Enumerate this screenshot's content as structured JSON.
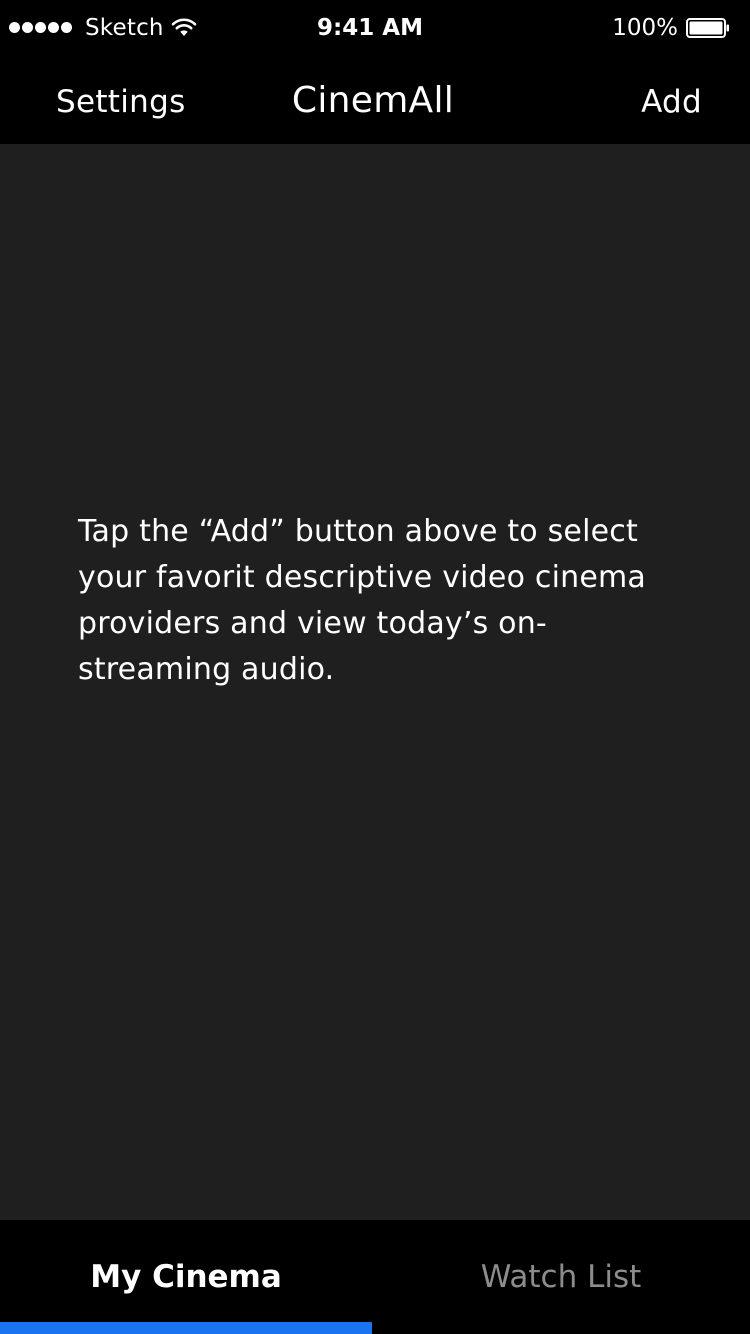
{
  "status_bar": {
    "carrier": "Sketch",
    "time": "9:41 AM",
    "battery_percent": "100%",
    "signal_bars": 5,
    "battery_level": 1.0,
    "icons": [
      "signal-dots-icon",
      "wifi-icon",
      "battery-icon"
    ]
  },
  "nav_bar": {
    "left_button_label": "Settings",
    "title": "CinemAll",
    "right_button_label": "Add"
  },
  "main": {
    "empty_state_message": "Tap the “Add” button above to select your favorit descriptive video cinema providers and view today’s on-streaming audio."
  },
  "tab_bar": {
    "tabs": [
      {
        "label": "My Cinema",
        "selected": true
      },
      {
        "label": "Watch List",
        "selected": false
      }
    ]
  },
  "colors": {
    "background": "#000000",
    "content_background": "#1f1f1f",
    "text_primary": "#ffffff",
    "text_inactive_tab": "#8c8c8c",
    "accent": "#1a73f0"
  }
}
